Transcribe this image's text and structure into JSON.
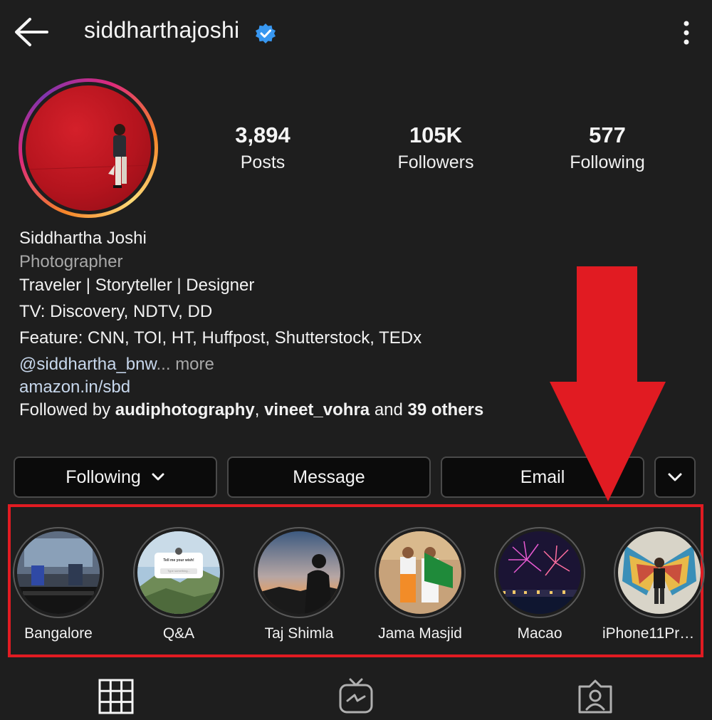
{
  "header": {
    "username": "siddharthajoshi",
    "icons": [
      "back-arrow-icon",
      "verified-badge-icon",
      "more-vertical-icon"
    ]
  },
  "stats": [
    {
      "value": "3,894",
      "label": "Posts"
    },
    {
      "value": "105K",
      "label": "Followers"
    },
    {
      "value": "577",
      "label": "Following"
    }
  ],
  "bio": {
    "name": "Siddhartha Joshi",
    "category": "Photographer",
    "line1": "Traveler | Storyteller | Designer",
    "line2": "TV: Discovery, NDTV, DD",
    "line3": "Feature: CNN, TOI, HT, Huffpost, Shutterstock, TEDx",
    "mention": "@siddhartha_bnw",
    "ellipsis": "...",
    "more": "more",
    "website": "amazon.in/sbd",
    "followed_prefix": "Followed by",
    "followed_user1": "audiphotography",
    "comma": ",",
    "followed_user2": "vineet_vohra",
    "and_text": "and",
    "followed_others": "39 others"
  },
  "buttons": {
    "following": "Following",
    "message": "Message",
    "email": "Email"
  },
  "highlights": [
    {
      "label": "Bangalore"
    },
    {
      "label": "Q&A",
      "card_title": "Tell me your wish!",
      "card_placeholder": "Type something..."
    },
    {
      "label": "Taj Shimla"
    },
    {
      "label": "Jama Masjid"
    },
    {
      "label": "Macao"
    },
    {
      "label": "iPhone11ProM..."
    }
  ],
  "tabs": [
    "grid-icon",
    "igtv-icon",
    "tagged-icon"
  ],
  "colors": {
    "background": "#1e1e1e",
    "annotation_red": "#e11b22",
    "verified_blue": "#3897f0"
  }
}
